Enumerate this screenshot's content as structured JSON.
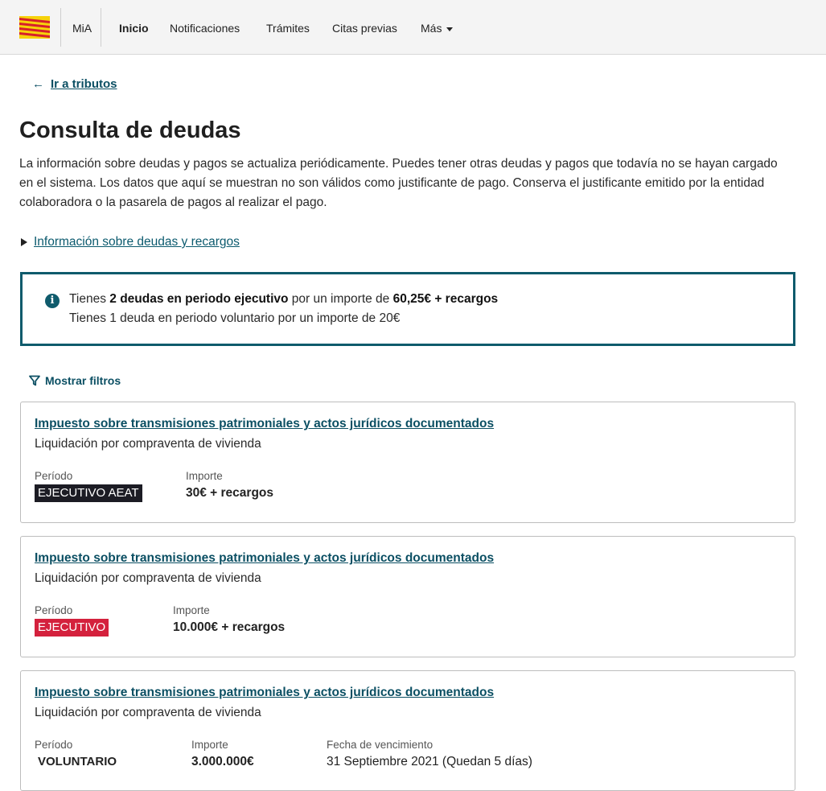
{
  "header": {
    "brand": "MiA",
    "nav": [
      {
        "label": "Inicio",
        "active": true
      },
      {
        "label": "Notificaciones",
        "active": false
      },
      {
        "label": "Trámites",
        "active": false
      },
      {
        "label": "Citas previas",
        "active": false
      },
      {
        "label": "Más",
        "active": false
      }
    ],
    "colors": {
      "logo_yellow": "#f6d20a",
      "logo_red": "#d61f2c"
    }
  },
  "back_link": {
    "icon": "arrow-left-icon",
    "label": "Ir a tributos"
  },
  "page_title": "Consulta de deudas",
  "intro": "La información sobre deudas y pagos se actualiza periódicamente. Puedes tener otras deudas y pagos que todavía no se hayan cargado en el sistema. Los datos que aquí se muestran no son válidos como justificante de pago. Conserva el justificante emitido por la entidad colaboradora o la pasarela de pagos al realizar el pago.",
  "details_toggle": "Información sobre deudas y recargos",
  "summary": {
    "icon": "info-icon",
    "line1": {
      "prefix": "Tienes ",
      "strong1": "2 deudas en periodo ejecutivo",
      "mid": " por un importe de ",
      "strong2": "60,25€ + recargos"
    },
    "line2": "Tienes 1 deuda en periodo voluntario por un importe de 20€"
  },
  "filters": {
    "icon": "filter-icon",
    "label": "Mostrar filtros"
  },
  "labels": {
    "period": "Período",
    "amount": "Importe",
    "due": "Fecha de vencimiento"
  },
  "debts": [
    {
      "title": "Impuesto sobre transmisiones patrimoniales y actos jurídicos documentados",
      "subtitle": "Liquidación por compraventa de vivienda",
      "period": "EJECUTIVO AEAT",
      "period_style": "dark",
      "amount": "30€ + recargos"
    },
    {
      "title": "Impuesto sobre transmisiones patrimoniales y actos jurídicos documentados",
      "subtitle": "Liquidación por compraventa de vivienda",
      "period": "EJECUTIVO",
      "period_style": "red",
      "amount": "10.000€ + recargos"
    },
    {
      "title": "Impuesto sobre transmisiones patrimoniales y actos jurídicos documentados",
      "subtitle": "Liquidación por compraventa de vivienda",
      "period": "VOLUNTARIO",
      "period_style": "plain",
      "amount": "3.000.000€",
      "due_date": "31 Septiembre 2021 (Quedan 5 días)"
    }
  ]
}
